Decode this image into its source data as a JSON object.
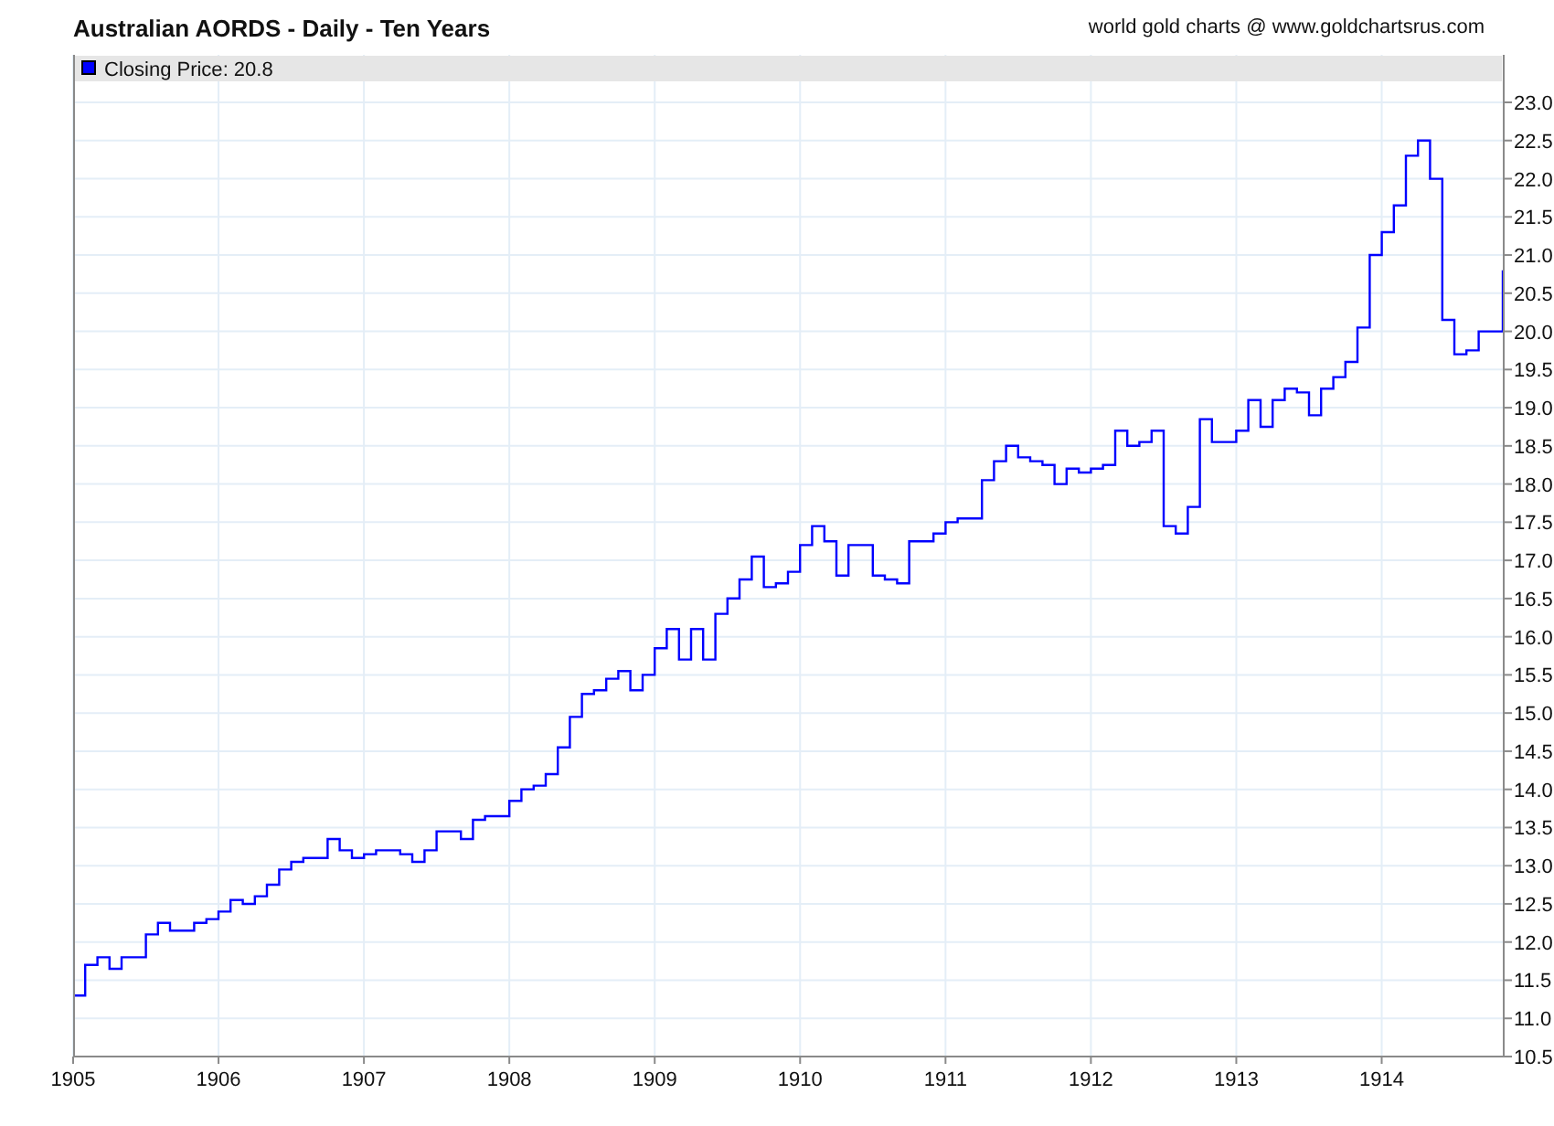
{
  "header": {
    "title": "Australian AORDS - Daily - Ten Years",
    "source": "world gold charts @ www.goldchartsrus.com"
  },
  "chart": {
    "legend_reading": ": 20.8",
    "chart_data": {
      "type": "line",
      "grid": true,
      "x": [
        1905,
        1905.083,
        1905.083,
        1905.167,
        1905.167,
        1905.25,
        1905.25,
        1905.333,
        1905.333,
        1905.5,
        1905.5,
        1905.583,
        1905.583,
        1905.667,
        1905.667,
        1905.833,
        1905.833,
        1905.917,
        1905.917,
        1906,
        1906,
        1906.083,
        1906.083,
        1906.167,
        1906.167,
        1906.25,
        1906.25,
        1906.333,
        1906.333,
        1906.417,
        1906.417,
        1906.5,
        1906.5,
        1906.583,
        1906.583,
        1906.75,
        1906.75,
        1906.833,
        1906.833,
        1906.917,
        1906.917,
        1907,
        1907,
        1907.083,
        1907.083,
        1907.25,
        1907.25,
        1907.333,
        1907.333,
        1907.417,
        1907.417,
        1907.5,
        1907.5,
        1907.667,
        1907.667,
        1907.75,
        1907.75,
        1907.833,
        1907.833,
        1908,
        1908,
        1908.083,
        1908.083,
        1908.167,
        1908.167,
        1908.25,
        1908.25,
        1908.333,
        1908.333,
        1908.417,
        1908.417,
        1908.5,
        1908.5,
        1908.583,
        1908.583,
        1908.667,
        1908.667,
        1908.75,
        1908.75,
        1908.833,
        1908.833,
        1908.917,
        1908.917,
        1909,
        1909,
        1909.083,
        1909.083,
        1909.167,
        1909.167,
        1909.25,
        1909.25,
        1909.333,
        1909.333,
        1909.417,
        1909.417,
        1909.5,
        1909.5,
        1909.583,
        1909.583,
        1909.667,
        1909.667,
        1909.75,
        1909.75,
        1909.833,
        1909.833,
        1909.917,
        1909.917,
        1910,
        1910,
        1910.083,
        1910.083,
        1910.167,
        1910.167,
        1910.25,
        1910.25,
        1910.333,
        1910.333,
        1910.5,
        1910.5,
        1910.583,
        1910.583,
        1910.667,
        1910.667,
        1910.75,
        1910.75,
        1910.917,
        1910.917,
        1911,
        1911,
        1911.083,
        1911.083,
        1911.25,
        1911.25,
        1911.333,
        1911.333,
        1911.417,
        1911.417,
        1911.5,
        1911.5,
        1911.583,
        1911.583,
        1911.667,
        1911.667,
        1911.75,
        1911.75,
        1911.833,
        1911.833,
        1911.917,
        1911.917,
        1912,
        1912,
        1912.083,
        1912.083,
        1912.167,
        1912.167,
        1912.25,
        1912.25,
        1912.333,
        1912.333,
        1912.417,
        1912.417,
        1912.5,
        1912.5,
        1912.583,
        1912.583,
        1912.667,
        1912.667,
        1912.75,
        1912.75,
        1912.833,
        1912.833,
        1913,
        1913,
        1913.083,
        1913.083,
        1913.167,
        1913.167,
        1913.25,
        1913.25,
        1913.333,
        1913.333,
        1913.417,
        1913.417,
        1913.5,
        1913.5,
        1913.583,
        1913.583,
        1913.667,
        1913.667,
        1913.75,
        1913.75,
        1913.833,
        1913.833,
        1913.917,
        1913.917,
        1914,
        1914,
        1914.083,
        1914.083,
        1914.167,
        1914.167,
        1914.25,
        1914.25,
        1914.333,
        1914.333,
        1914.417,
        1914.417,
        1914.5,
        1914.5,
        1914.583,
        1914.583,
        1914.667,
        1914.667,
        1914.833,
        1914.833
      ],
      "series": [
        {
          "name": "Closing Price",
          "color": "#0000ff",
          "values": [
            11.3,
            11.3,
            11.7,
            11.7,
            11.8,
            11.8,
            11.65,
            11.65,
            11.8,
            11.8,
            12.1,
            12.1,
            12.25,
            12.25,
            12.15,
            12.15,
            12.25,
            12.25,
            12.3,
            12.3,
            12.4,
            12.4,
            12.55,
            12.55,
            12.5,
            12.5,
            12.6,
            12.6,
            12.75,
            12.75,
            12.95,
            12.95,
            13.05,
            13.05,
            13.1,
            13.1,
            13.35,
            13.35,
            13.2,
            13.2,
            13.1,
            13.1,
            13.15,
            13.15,
            13.2,
            13.2,
            13.15,
            13.15,
            13.05,
            13.05,
            13.2,
            13.2,
            13.45,
            13.45,
            13.35,
            13.35,
            13.6,
            13.6,
            13.65,
            13.65,
            13.85,
            13.85,
            14.0,
            14.0,
            14.05,
            14.05,
            14.2,
            14.2,
            14.55,
            14.55,
            14.95,
            14.95,
            15.25,
            15.25,
            15.3,
            15.3,
            15.45,
            15.45,
            15.55,
            15.55,
            15.3,
            15.3,
            15.5,
            15.5,
            15.85,
            15.85,
            16.1,
            16.1,
            15.7,
            15.7,
            16.1,
            16.1,
            15.7,
            15.7,
            16.3,
            16.3,
            16.5,
            16.5,
            16.75,
            16.75,
            17.05,
            17.05,
            16.65,
            16.65,
            16.7,
            16.7,
            16.85,
            16.85,
            17.2,
            17.2,
            17.45,
            17.45,
            17.25,
            17.25,
            16.8,
            16.8,
            17.2,
            17.2,
            16.8,
            16.8,
            16.75,
            16.75,
            16.7,
            16.7,
            17.25,
            17.25,
            17.35,
            17.35,
            17.5,
            17.5,
            17.55,
            17.55,
            18.05,
            18.05,
            18.3,
            18.3,
            18.5,
            18.5,
            18.35,
            18.35,
            18.3,
            18.3,
            18.25,
            18.25,
            18.0,
            18.0,
            18.2,
            18.2,
            18.15,
            18.15,
            18.2,
            18.2,
            18.25,
            18.25,
            18.7,
            18.7,
            18.5,
            18.5,
            18.55,
            18.55,
            18.7,
            18.7,
            17.45,
            17.45,
            17.35,
            17.35,
            17.7,
            17.7,
            18.85,
            18.85,
            18.55,
            18.55,
            18.7,
            18.7,
            19.1,
            19.1,
            18.75,
            18.75,
            19.1,
            19.1,
            19.25,
            19.25,
            19.2,
            19.2,
            18.9,
            18.9,
            19.25,
            19.25,
            19.4,
            19.4,
            19.6,
            19.6,
            20.05,
            20.05,
            21.0,
            21.0,
            21.3,
            21.3,
            21.65,
            21.65,
            22.3,
            22.3,
            22.5,
            22.5,
            22.0,
            22.0,
            20.15,
            20.15,
            19.7,
            19.7,
            19.75,
            19.75,
            20.0,
            20.0,
            20.8
          ]
        }
      ],
      "xlim": [
        1905,
        1914.833
      ],
      "ylim": [
        10.5,
        23.0
      ],
      "xticks": [
        1905,
        1906,
        1907,
        1908,
        1909,
        1910,
        1911,
        1912,
        1913,
        1914
      ],
      "yticks": [
        {
          "value": 10.5,
          "label": "10.5"
        },
        {
          "value": 11,
          "label": "11.0"
        },
        {
          "value": 11.5,
          "label": "11.5"
        },
        {
          "value": 12,
          "label": "12.0"
        },
        {
          "value": 12.5,
          "label": "12.5"
        },
        {
          "value": 13,
          "label": "13.0"
        },
        {
          "value": 13.5,
          "label": "13.5"
        },
        {
          "value": 14,
          "label": "14.0"
        },
        {
          "value": 14.5,
          "label": "14.5"
        },
        {
          "value": 15,
          "label": "15.0"
        },
        {
          "value": 15.5,
          "label": "15.5"
        },
        {
          "value": 16,
          "label": "16.0"
        },
        {
          "value": 16.5,
          "label": "16.5"
        },
        {
          "value": 17,
          "label": "17.0"
        },
        {
          "value": 17.5,
          "label": "17.5"
        },
        {
          "value": 18,
          "label": "18.0"
        },
        {
          "value": 18.5,
          "label": "18.5"
        },
        {
          "value": 19,
          "label": "19.0"
        },
        {
          "value": 19.5,
          "label": "19.5"
        },
        {
          "value": 20,
          "label": "20.0"
        },
        {
          "value": 20.5,
          "label": "20.5"
        },
        {
          "value": 21,
          "label": "21.0"
        },
        {
          "value": 21.5,
          "label": "21.5"
        },
        {
          "value": 22,
          "label": "22.0"
        },
        {
          "value": 22.5,
          "label": "22.5"
        },
        {
          "value": 23,
          "label": "23.0"
        }
      ]
    }
  }
}
